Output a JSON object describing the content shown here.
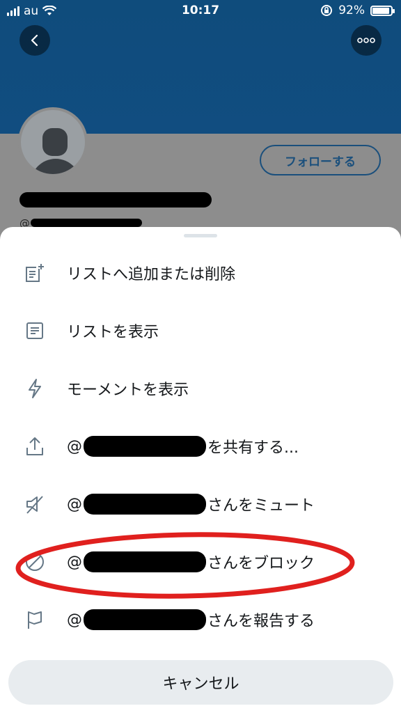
{
  "status_bar": {
    "carrier": "au",
    "time": "10:17",
    "battery": "92%",
    "battery_level": 0.92
  },
  "profile": {
    "follow_label": "フォローする",
    "handle_prefix": "@"
  },
  "menu": {
    "items": [
      {
        "icon": "list-add-icon",
        "text": "リストへ追加または削除"
      },
      {
        "icon": "list-icon",
        "text": "リストを表示"
      },
      {
        "icon": "lightning-icon",
        "text": "モーメントを表示"
      },
      {
        "icon": "share-icon",
        "prefix": "@",
        "suffix": "を共有する..."
      },
      {
        "icon": "mute-icon",
        "prefix": "@",
        "suffix": "さんをミュート"
      },
      {
        "icon": "block-icon",
        "prefix": "@",
        "suffix": "さんをブロック"
      },
      {
        "icon": "flag-icon",
        "prefix": "@",
        "suffix": "さんを報告する"
      }
    ],
    "cancel_label": "キャンセル"
  },
  "colors": {
    "banner": "#114d80",
    "annotation": "#e0201e",
    "icon": "#657786"
  }
}
